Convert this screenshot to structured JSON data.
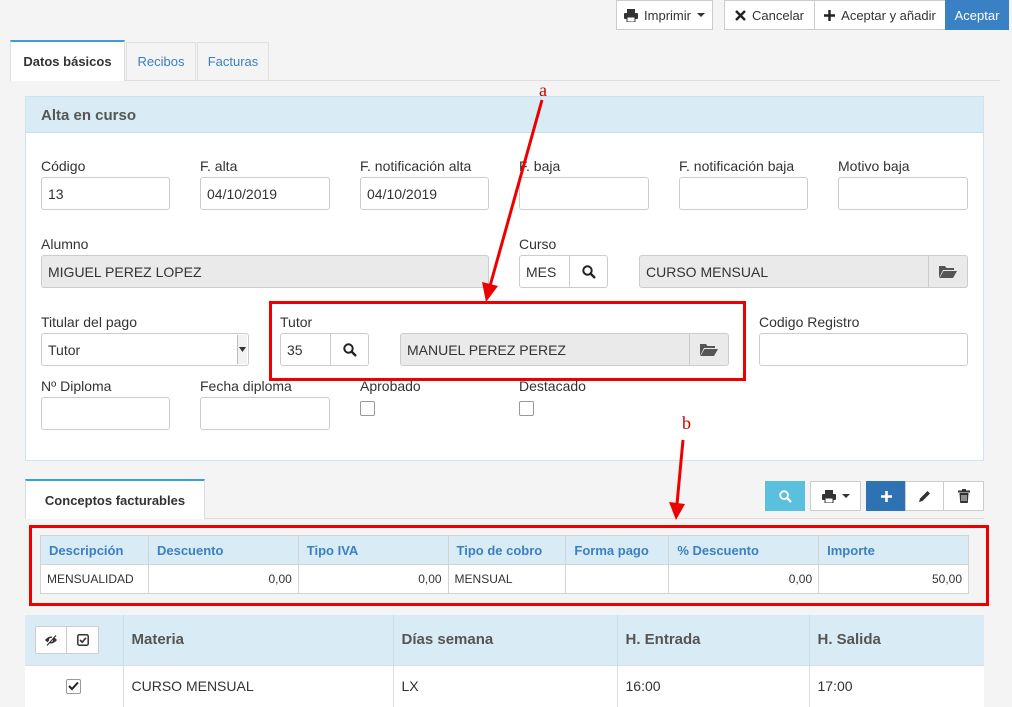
{
  "toolbar": {
    "print_label": "Imprimir",
    "cancel_label": "Cancelar",
    "accept_add_label": "Aceptar y añadir",
    "accept_label": "Aceptar"
  },
  "tabs": [
    {
      "label": "Datos básicos"
    },
    {
      "label": "Recibos"
    },
    {
      "label": "Facturas"
    }
  ],
  "panel": {
    "title": "Alta en curso",
    "fields": {
      "codigo": {
        "label": "Código",
        "value": "13"
      },
      "f_alta": {
        "label": "F. alta",
        "value": "04/10/2019"
      },
      "f_notif_alta": {
        "label": "F. notificación alta",
        "value": "04/10/2019"
      },
      "f_baja": {
        "label": "F. baja",
        "value": ""
      },
      "f_notif_baja": {
        "label": "F. notificación baja",
        "value": ""
      },
      "motivo_baja": {
        "label": "Motivo baja",
        "value": ""
      },
      "alumno": {
        "label": "Alumno",
        "value": "MIGUEL PEREZ LOPEZ"
      },
      "curso": {
        "label": "Curso",
        "code": "MES",
        "name": "CURSO MENSUAL"
      },
      "titular": {
        "label": "Titular del pago",
        "value": "Tutor"
      },
      "tutor": {
        "label": "Tutor",
        "code": "35",
        "name": "MANUEL PEREZ PEREZ"
      },
      "codigo_registro": {
        "label": "Codigo Registro",
        "value": ""
      },
      "n_diploma": {
        "label": "Nº Diploma",
        "value": ""
      },
      "fecha_diploma": {
        "label": "Fecha diploma",
        "value": ""
      },
      "aprobado": {
        "label": "Aprobado"
      },
      "destacado": {
        "label": "Destacado"
      }
    }
  },
  "annotations": {
    "a": "a",
    "b": "b"
  },
  "conceptos": {
    "tab_label": "Conceptos facturables",
    "columns": [
      "Descripción",
      "Descuento",
      "Tipo IVA",
      "Tipo de cobro",
      "Forma pago",
      "% Descuento",
      "Importe"
    ],
    "rows": [
      [
        "MENSUALIDAD",
        "0,00",
        "0,00",
        "MENSUAL",
        "",
        "0,00",
        "50,00"
      ]
    ]
  },
  "materias": {
    "columns": [
      "Materia",
      "Días semana",
      "H. Entrada",
      "H. Salida"
    ],
    "rows": [
      [
        "CURSO MENSUAL",
        "LX",
        "16:00",
        "17:00"
      ]
    ]
  },
  "colors": {
    "accent": "#3a80c4",
    "header_bg": "#d9ecf5",
    "annotation": "#e00000"
  }
}
